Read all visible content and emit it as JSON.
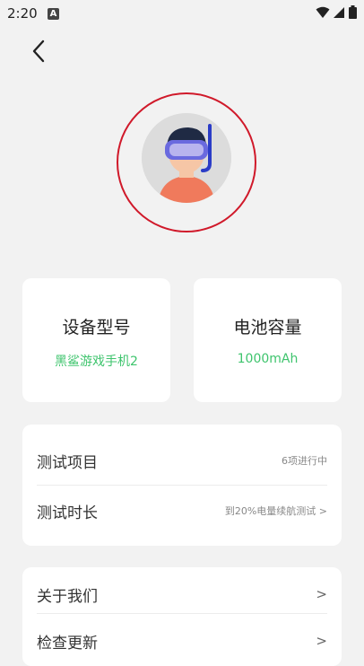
{
  "status": {
    "time": "2:20",
    "badge": "A"
  },
  "device_card": {
    "title": "设备型号",
    "value": "黑鲨游戏手机2"
  },
  "battery_card": {
    "title": "电池容量",
    "value": "1000mAh"
  },
  "tests": {
    "items": [
      {
        "label": "测试项目",
        "value": "6项进行中"
      },
      {
        "label": "测试时长",
        "value": "到20%电量续航测试 >"
      }
    ]
  },
  "menu": {
    "items": [
      {
        "label": "关于我们",
        "arrow": ">"
      },
      {
        "label": "检查更新",
        "arrow": ">"
      }
    ]
  },
  "colors": {
    "accent_green": "#3ec46d",
    "ring_red": "#d0192a"
  }
}
